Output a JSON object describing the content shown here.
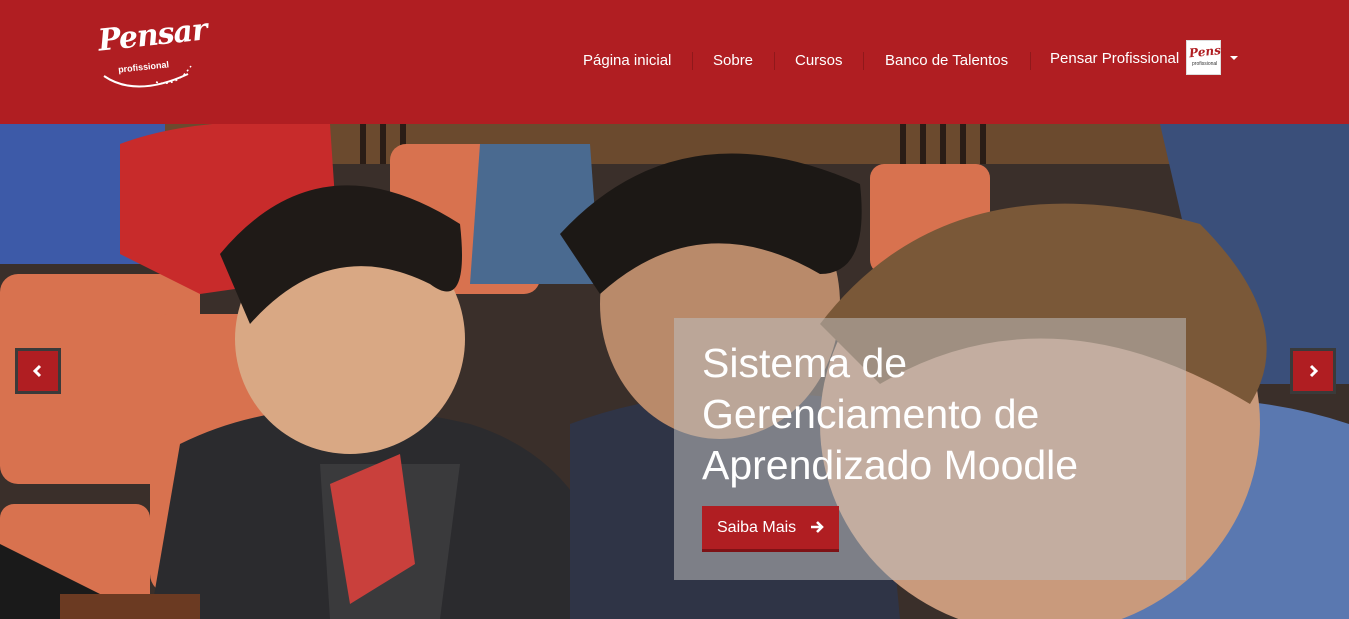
{
  "header": {
    "logo": {
      "wordmark": "Pensar",
      "sub": "profissional"
    },
    "nav": [
      {
        "label": "Página inicial"
      },
      {
        "label": "Sobre"
      },
      {
        "label": "Cursos"
      },
      {
        "label": "Banco de Talentos"
      }
    ],
    "user_menu": {
      "label": "Pensar Profissional",
      "avatar_text": "Pensar",
      "avatar_sub": "profissional"
    }
  },
  "carousel": {
    "caption_title": "Sistema de Gerenciamento de Aprendizado Moodle",
    "cta_label": "Saiba Mais",
    "prev_icon": "chevron-left-icon",
    "next_icon": "chevron-right-icon"
  },
  "colors": {
    "brand": "#b01e22",
    "caption_overlay": "rgba(190,190,190,0.55)"
  }
}
